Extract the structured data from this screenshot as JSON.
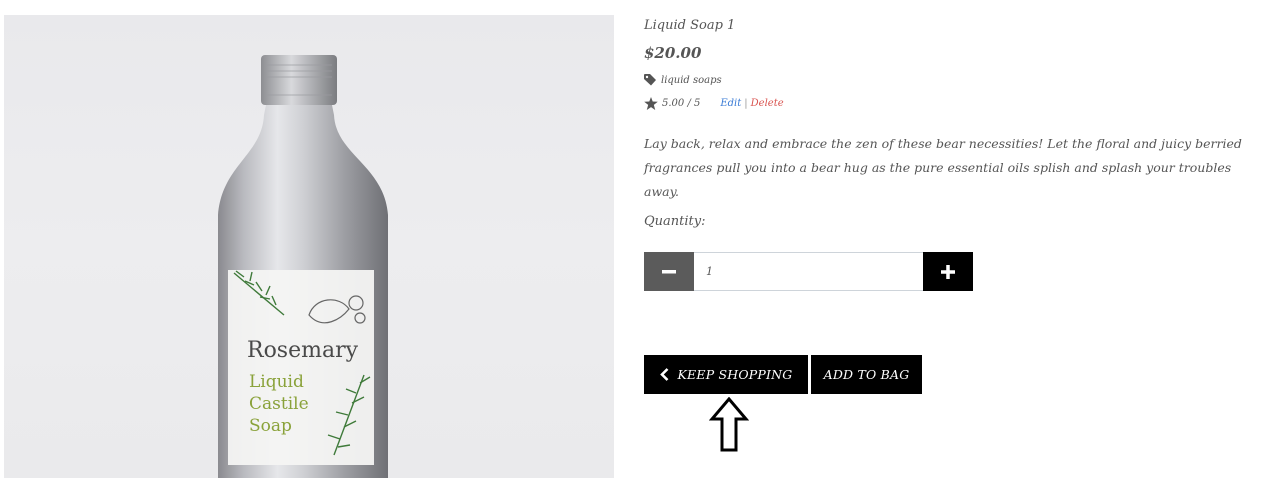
{
  "product": {
    "name": "Liquid Soap 1",
    "price": "$20.00",
    "category": "liquid soaps",
    "rating": "5.00 / 5",
    "edit_label": "Edit",
    "separator": "|",
    "delete_label": "Delete",
    "description": "Lay back, relax and embrace the zen of these bear necessities! Let the floral and juicy berried fragrances pull you into a bear hug as the pure essential oils splish and splash your troubles away."
  },
  "image_label": {
    "line1": "Rosemary",
    "line2": "Liquid",
    "line3": "Castile",
    "line4": "Soap"
  },
  "quantity": {
    "label": "Quantity:",
    "value": "1"
  },
  "buttons": {
    "keep_shopping": "KEEP SHOPPING",
    "add_to_bag": "ADD TO BAG"
  },
  "icons": {
    "tag": "tag-icon",
    "star": "star-icon",
    "minus": "minus-icon",
    "plus": "plus-icon",
    "chevron": "chevron-left-icon",
    "arrow": "up-arrow-icon"
  },
  "colors": {
    "edit_link": "#3a7bd5",
    "delete_link": "#d9534f",
    "minus_button": "#5b5b5b",
    "primary_button": "#000000"
  }
}
